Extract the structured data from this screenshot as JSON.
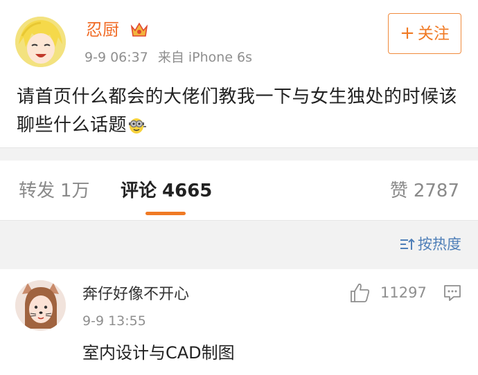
{
  "post": {
    "username": "忍厨",
    "time": "9-9 06:37",
    "source": "来自 iPhone 6s",
    "follow_label": "关注",
    "follow_plus": "+",
    "text": "请首页什么都会的大佬们教我一下与女生独处的时候该聊些什么话题",
    "emoji_icon": "minion-emoji-icon",
    "badge_icon": "crown-badge-icon"
  },
  "tabs": {
    "repost_label": "转发",
    "repost_count": "1万",
    "comment_label": "评论",
    "comment_count": "4665",
    "like_label": "赞",
    "like_count": "2787"
  },
  "sort": {
    "label": "按热度"
  },
  "comment": {
    "username": "奔仔好像不开心",
    "time": "9-9 13:55",
    "text": "室内设计与CAD制图",
    "like_count": "11297"
  },
  "colors": {
    "accent": "#f07a24",
    "link": "#4f7fb8",
    "muted": "#8f8f8f",
    "divider_bg": "#f2f2f2"
  }
}
